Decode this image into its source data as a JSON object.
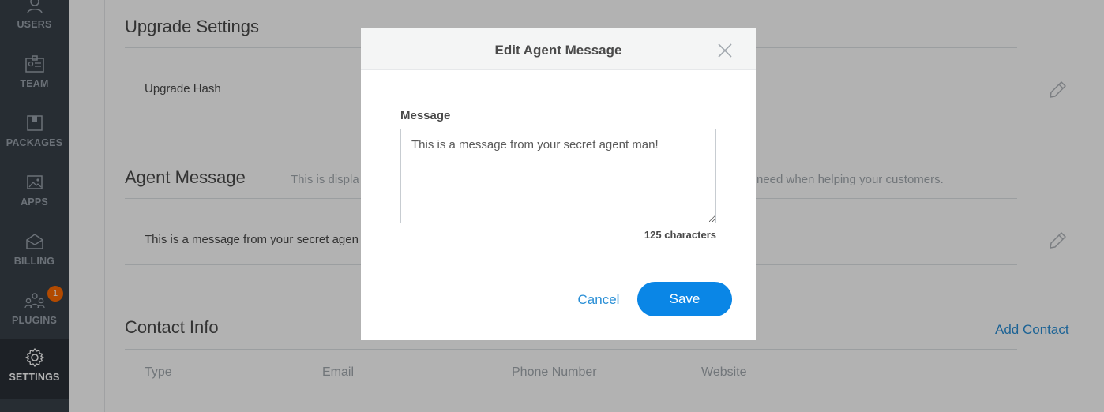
{
  "sidebar": {
    "items": [
      {
        "label": "USERS",
        "icon": "users-icon"
      },
      {
        "label": "TEAM",
        "icon": "team-icon"
      },
      {
        "label": "PACKAGES",
        "icon": "packages-icon"
      },
      {
        "label": "APPS",
        "icon": "apps-icon"
      },
      {
        "label": "BILLING",
        "icon": "billing-icon"
      },
      {
        "label": "PLUGINS",
        "icon": "plugins-icon",
        "badge": "1"
      },
      {
        "label": "SETTINGS",
        "icon": "gear-icon",
        "active": true
      }
    ]
  },
  "upgrade": {
    "title": "Upgrade Settings",
    "row_label": "Upgrade Hash"
  },
  "agent": {
    "title": "Agent Message",
    "desc_left": "This is displa",
    "desc_right": "need when helping your customers.",
    "value": "This is a message from your secret agen"
  },
  "contact": {
    "title": "Contact Info",
    "add_label": "Add Contact",
    "columns": [
      "Type",
      "Email",
      "Phone Number",
      "Website"
    ]
  },
  "modal": {
    "title": "Edit Agent Message",
    "field_label": "Message",
    "message": "This is a message from your secret agent man!",
    "char_count": "125 characters",
    "cancel_label": "Cancel",
    "save_label": "Save"
  },
  "colors": {
    "sidebar_bg": "#394149",
    "sidebar_active": "#2a3037",
    "accent": "#0a86e6",
    "link": "#2a8fd6",
    "badge": "#ff6a00"
  }
}
